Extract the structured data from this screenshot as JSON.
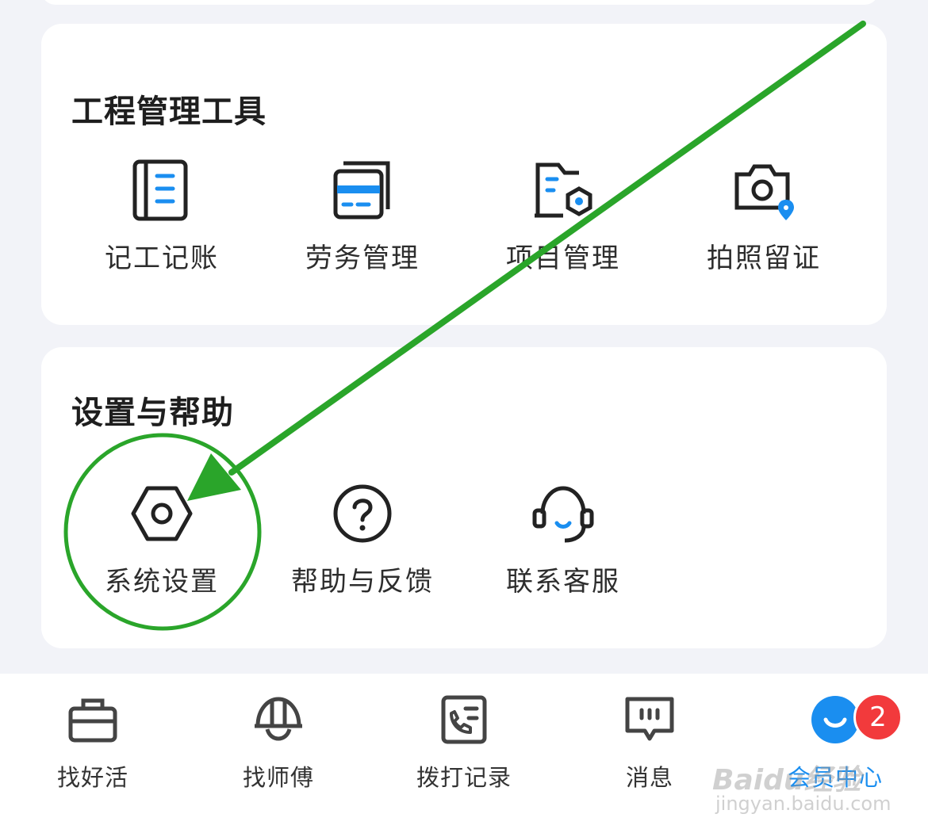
{
  "tools_section": {
    "title": "工程管理工具",
    "items": [
      {
        "label": "记工记账",
        "icon": "ledger-icon"
      },
      {
        "label": "劳务管理",
        "icon": "labor-card-icon"
      },
      {
        "label": "项目管理",
        "icon": "project-folder-icon"
      },
      {
        "label": "拍照留证",
        "icon": "camera-location-icon"
      }
    ]
  },
  "settings_section": {
    "title": "设置与帮助",
    "items": [
      {
        "label": "系统设置",
        "icon": "settings-hex-icon"
      },
      {
        "label": "帮助与反馈",
        "icon": "help-question-icon"
      },
      {
        "label": "联系客服",
        "icon": "headset-icon"
      }
    ]
  },
  "bottom_nav": {
    "items": [
      {
        "label": "找好活",
        "icon": "briefcase-icon"
      },
      {
        "label": "找师傅",
        "icon": "hardhat-icon"
      },
      {
        "label": "拨打记录",
        "icon": "call-log-icon"
      },
      {
        "label": "消息",
        "icon": "message-icon"
      },
      {
        "label": "会员中心",
        "icon": "member-avatar-icon",
        "active": true,
        "badge": "2"
      }
    ]
  },
  "watermark": {
    "brand": "Baidu经验",
    "url": "jingyan.baidu.com"
  },
  "colors": {
    "accent": "#1a8ef0",
    "icon_stroke": "#222222",
    "badge": "#f23a3c",
    "annotation": "#2aa52a",
    "background": "#f2f3f8"
  }
}
